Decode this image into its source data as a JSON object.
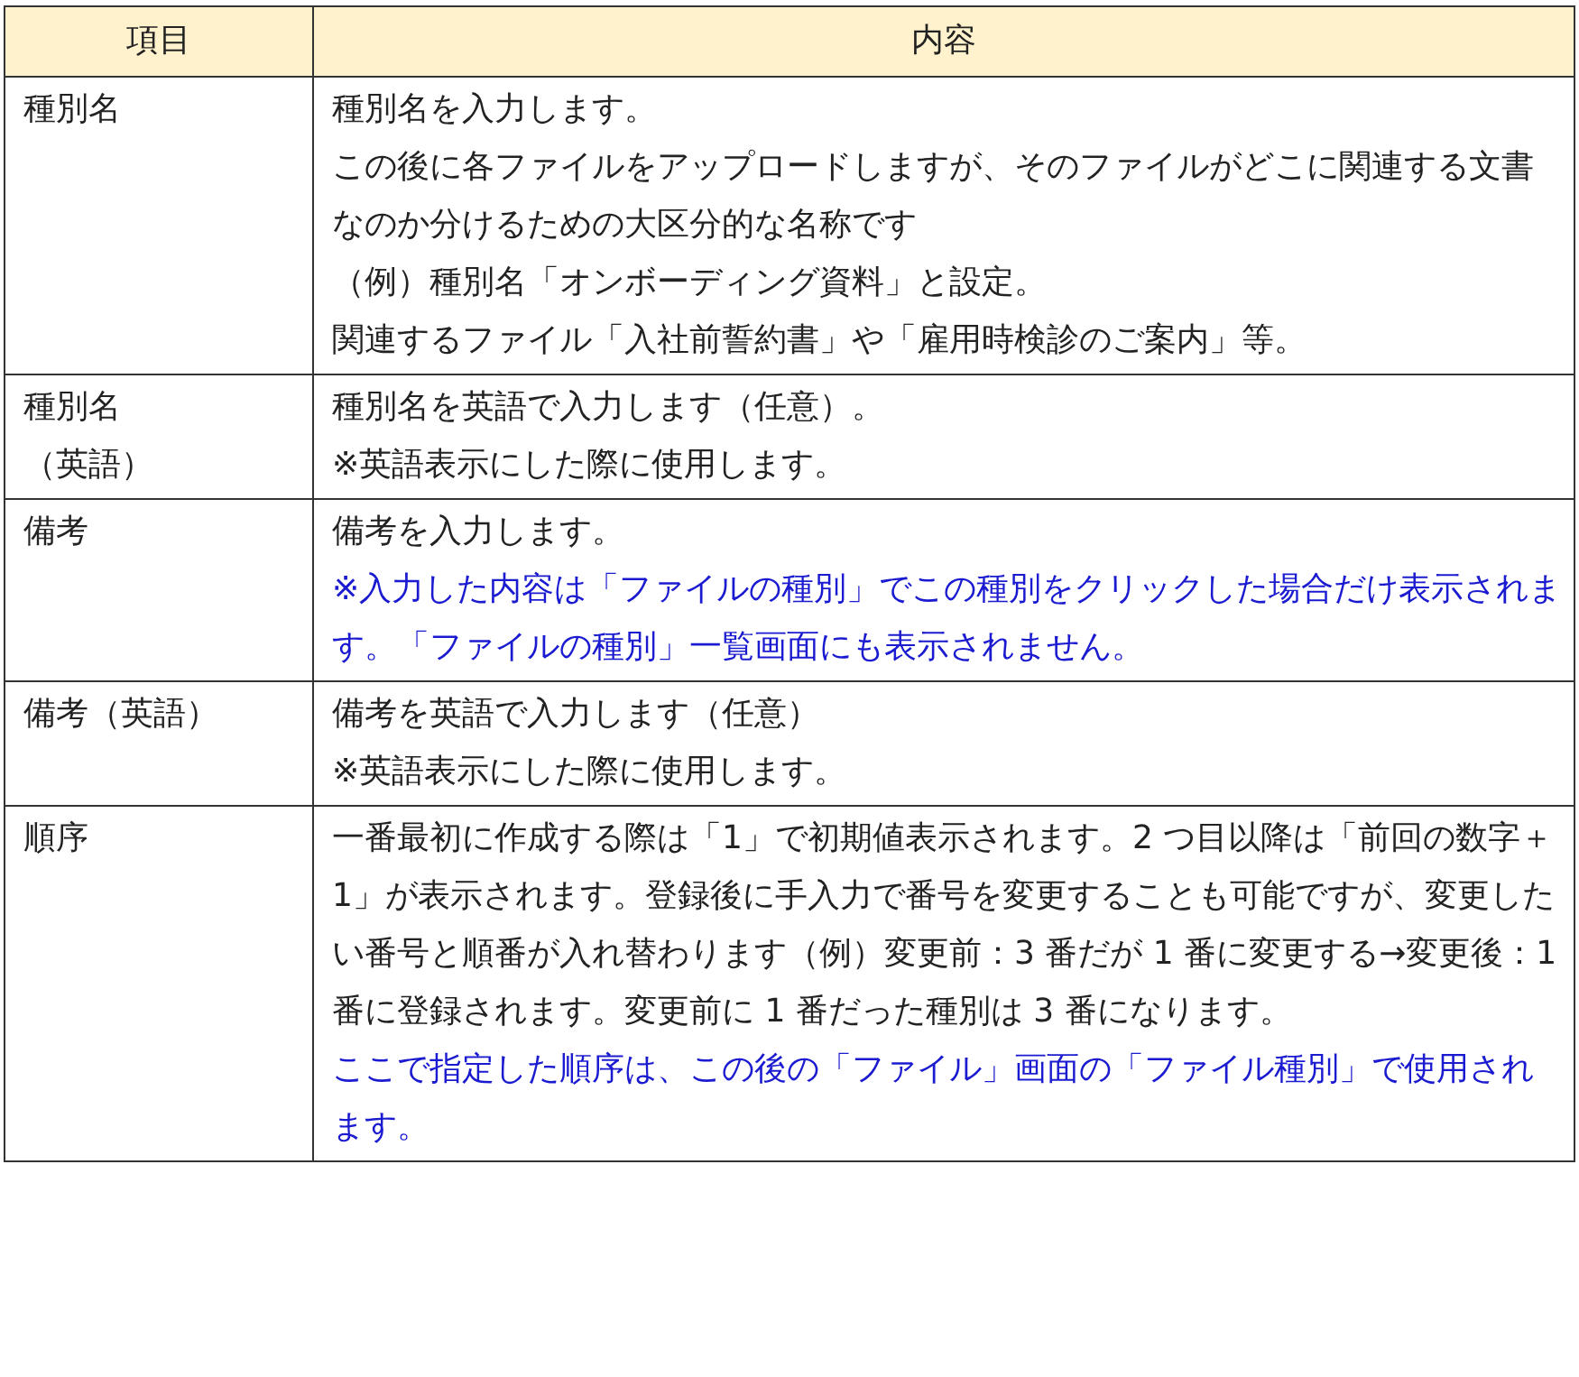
{
  "table": {
    "columns": [
      "項目",
      "内容"
    ],
    "rows": [
      {
        "label": [
          "種別名"
        ],
        "content": [
          {
            "kind": "normal",
            "text": "種別名を入力します。"
          },
          {
            "kind": "normal",
            "text": "この後に各ファイルをアップロードしますが、そのファイルがどこに関連する文書なのか分けるための大区分的な名称です"
          },
          {
            "kind": "normal",
            "text": "（例）種別名「オンボーディング資料」と設定。"
          },
          {
            "kind": "normal",
            "text": "関連するファイル「入社前誓約書」や「雇用時検診のご案内」等。"
          }
        ]
      },
      {
        "label": [
          "種別名",
          "（英語）"
        ],
        "content": [
          {
            "kind": "normal",
            "text": "種別名を英語で入力します（任意）。"
          },
          {
            "kind": "normal",
            "text": "※英語表示にした際に使用します。"
          }
        ]
      },
      {
        "label": [
          "備考"
        ],
        "content": [
          {
            "kind": "normal",
            "text": "備考を入力します。"
          },
          {
            "kind": "note",
            "text": "※入力した内容は「ファイルの種別」でこの種別をクリックした場合だけ表示されます。「ファイルの種別」一覧画面にも表示されません。"
          }
        ]
      },
      {
        "label": [
          "備考（英語）"
        ],
        "content": [
          {
            "kind": "normal",
            "text": "備考を英語で入力します（任意）"
          },
          {
            "kind": "normal",
            "text": "※英語表示にした際に使用します。"
          }
        ]
      },
      {
        "label": [
          "順序"
        ],
        "content": [
          {
            "kind": "normal",
            "text": "一番最初に作成する際は「1」で初期値表示されます。2 つ目以降は「前回の数字＋1」が表示されます。登録後に手入力で番号を変更することも可能ですが、変更したい番号と順番が入れ替わります（例）変更前：3 番だが 1 番に変更する→変更後：1 番に登録されます。変更前に 1 番だった種別は 3 番になります。"
          },
          {
            "kind": "note",
            "text": "ここで指定した順序は、この後の「ファイル」画面の「ファイル種別」で使用されます。"
          }
        ]
      }
    ]
  }
}
